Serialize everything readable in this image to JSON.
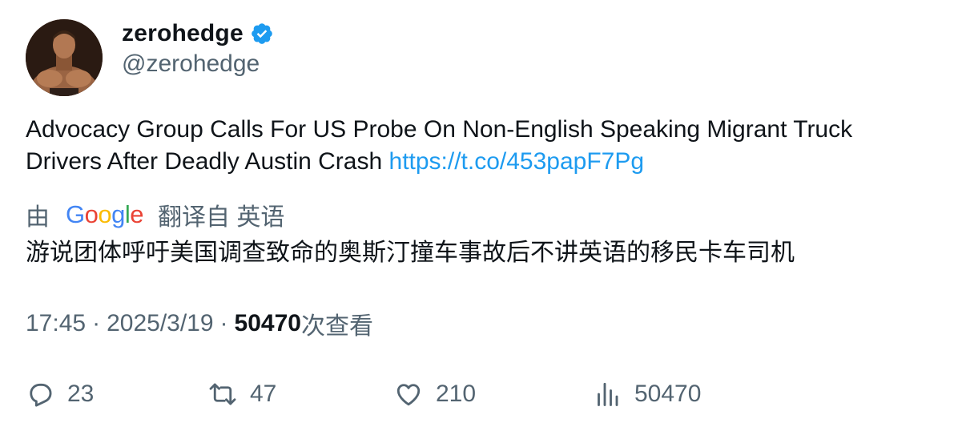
{
  "author": {
    "display_name": "zerohedge",
    "handle": "@zerohedge",
    "verified_color": "#1d9bf0"
  },
  "tweet": {
    "text": "Advocacy Group Calls For US Probe On Non-English Speaking Migrant Truck Drivers After Deadly Austin Crash ",
    "link": "https://t.co/453papF7Pg"
  },
  "translation": {
    "prefix": "由",
    "provider": "Google",
    "suffix": "翻译自 英语",
    "text": "游说团体呼吁美国调查致命的奥斯汀撞车事故后不讲英语的移民卡车司机"
  },
  "meta": {
    "time": "17:45",
    "date": "2025/3/19",
    "views": "50470",
    "views_label": "次查看"
  },
  "actions": {
    "replies": "23",
    "retweets": "47",
    "likes": "210",
    "views": "50470"
  },
  "colors": {
    "link": "#1d9bf0",
    "secondary_text": "#536471",
    "primary_text": "#0f1419"
  }
}
